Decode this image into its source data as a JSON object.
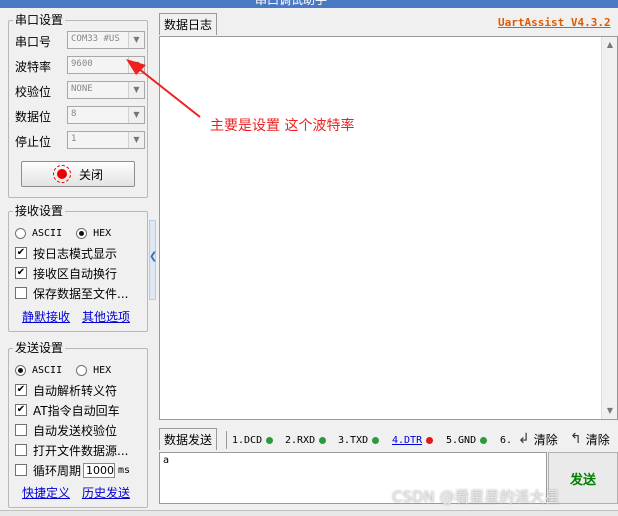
{
  "window": {
    "title": "串口调试助手"
  },
  "serial_settings": {
    "title": "串口设置",
    "fields": [
      {
        "label": "串口号",
        "value": "COM33 #US"
      },
      {
        "label": "波特率",
        "value": "9600"
      },
      {
        "label": "校验位",
        "value": "NONE"
      },
      {
        "label": "数据位",
        "value": "8"
      },
      {
        "label": "停止位",
        "value": "1"
      }
    ],
    "close_button": "关闭"
  },
  "receive_settings": {
    "title": "接收设置",
    "mode_ascii": "ASCII",
    "mode_hex": "HEX",
    "selected_mode": "HEX",
    "options": [
      {
        "label": "按日志模式显示",
        "checked": true
      },
      {
        "label": "接收区自动换行",
        "checked": true
      },
      {
        "label": "保存数据至文件...",
        "checked": false
      }
    ],
    "links": [
      "静默接收",
      "其他选项"
    ]
  },
  "send_settings": {
    "title": "发送设置",
    "mode_ascii": "ASCII",
    "mode_hex": "HEX",
    "selected_mode": "ASCII",
    "options": [
      {
        "label": "自动解析转义符",
        "checked": true
      },
      {
        "label": "AT指令自动回车",
        "checked": true
      },
      {
        "label": "自动发送校验位",
        "checked": false
      },
      {
        "label": "打开文件数据源...",
        "checked": false
      },
      {
        "label": "循环周期",
        "checked": false
      }
    ],
    "cycle_value": "1000",
    "cycle_unit": "ms",
    "links": [
      "快捷定义",
      "历史发送"
    ]
  },
  "log_panel": {
    "tab": "数据日志",
    "version": "UartAssist V4.3.2",
    "annotation": "主要是设置 这个波特率"
  },
  "send_panel": {
    "tab": "数据发送",
    "signals": [
      {
        "label": "1.DCD",
        "color": "#2a9a3a",
        "link": false
      },
      {
        "label": "2.RXD",
        "color": "#2a9a3a",
        "link": false
      },
      {
        "label": "3.TXD",
        "color": "#2a9a3a",
        "link": false
      },
      {
        "label": "4.DTR",
        "color": "#e01818",
        "link": true
      },
      {
        "label": "5.GND",
        "color": "#2a9a3a",
        "link": false
      },
      {
        "label": "6.",
        "color": "",
        "link": false
      }
    ],
    "clear1": "清除",
    "clear2": "清除",
    "send_text": "a",
    "send_button": "发送"
  },
  "watermark": "CSDN @看星星的派大星",
  "colors": {
    "accent_link": "#0000d8",
    "version": "#e05a00",
    "annotation": "#f02020",
    "send": "#008000"
  }
}
